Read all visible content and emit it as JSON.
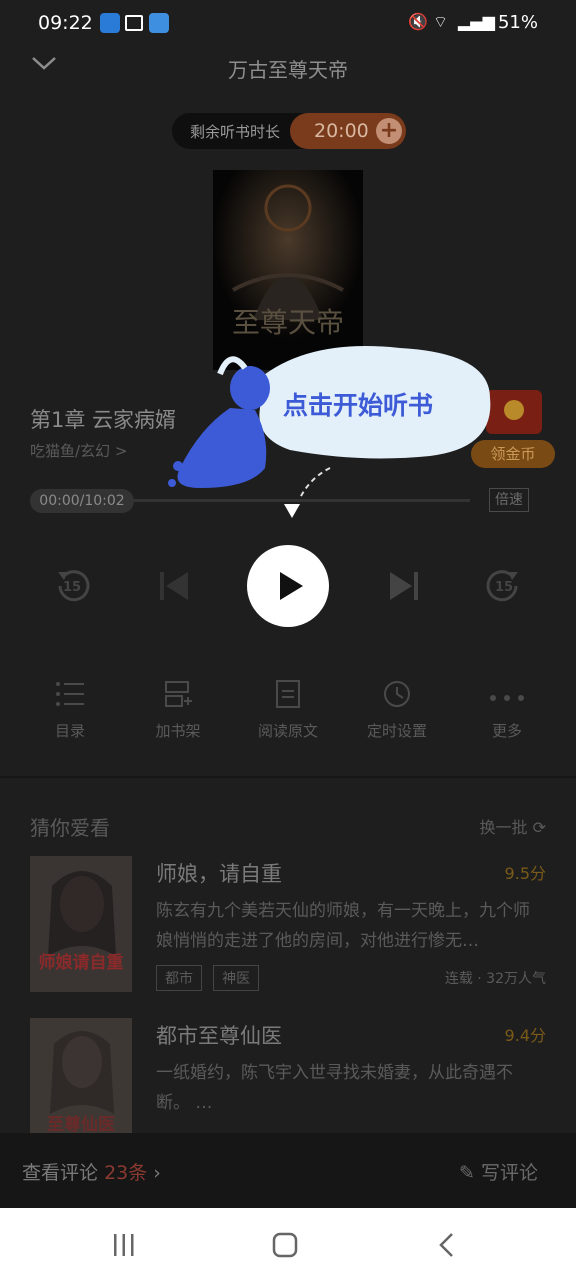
{
  "status_bar": {
    "time": "09:22",
    "battery": "51%"
  },
  "header": {
    "title": "万古至尊天帝"
  },
  "timer": {
    "label": "剩余听书时长",
    "value": "20:00"
  },
  "chapter": {
    "title": "第1章  云家病婿",
    "author_genre": "吃猫鱼/玄幻  >"
  },
  "reward": {
    "label": "领金币"
  },
  "player": {
    "progress": "00:00/10:02",
    "speed_label": "倍速",
    "skip_back": "15",
    "skip_fwd": "15"
  },
  "actions": [
    {
      "label": "目录"
    },
    {
      "label": "加书架"
    },
    {
      "label": "阅读原文"
    },
    {
      "label": "定时设置"
    },
    {
      "label": "更多"
    }
  ],
  "recommend": {
    "heading": "猜你爱看",
    "refresh": "换一批",
    "books": [
      {
        "title": "师娘，请自重",
        "score": "9.5分",
        "desc": "陈玄有九个美若天仙的师娘，有一天晚上，九个师娘悄悄的走进了他的房间，对他进行惨无…",
        "tags": [
          "都市",
          "神医"
        ],
        "meta": "连载 · 32万人气",
        "cover_text": "师娘请自重"
      },
      {
        "title": "都市至尊仙医",
        "score": "9.4分",
        "desc": "一纸婚约，陈飞宇入世寻找未婚妻，从此奇遇不断。 …",
        "tags": [],
        "meta": "",
        "cover_text": "至尊仙医"
      }
    ]
  },
  "comments": {
    "see_label": "查看评论",
    "count": "23条",
    "write_label": "写评论"
  },
  "coach": {
    "text": "点击开始听书"
  },
  "colors": {
    "accent_orange": "#c8762e",
    "coach_blue": "#3d5bd6"
  }
}
